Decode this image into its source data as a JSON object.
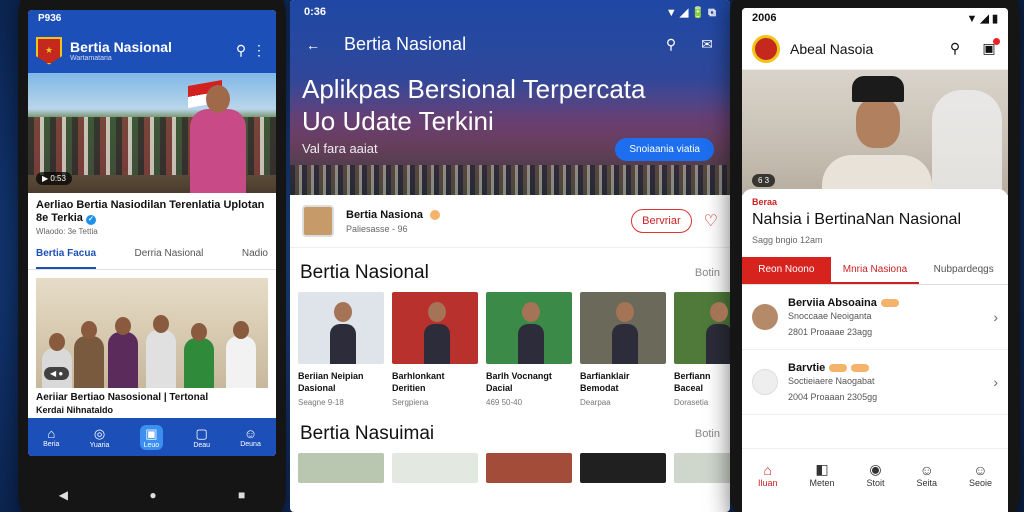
{
  "left": {
    "status_time": "P936",
    "app_title": "Bertia Nasional",
    "app_subtitle": "Wartamataria",
    "hero_badge": "0:53",
    "headline": "Aerliao Bertia Nasiodilan Terenlatia Uplotan 8e Terkia",
    "sub": "Wlaodo: 3e Tettia",
    "tabs": [
      "Bertia Facua",
      "Derria Nasional",
      "Nadio"
    ],
    "caption": "Aeriiar Bertiao Nasosional | Tertonal",
    "caption2": "Kerdai Nihnataldo",
    "nav": [
      {
        "icon": "⌂",
        "label": "Beria"
      },
      {
        "icon": "◎",
        "label": "Yuaria"
      },
      {
        "icon": "▣",
        "label": "Leuo"
      },
      {
        "icon": "▢",
        "label": "Deau"
      },
      {
        "icon": "☺",
        "label": "Deuna"
      }
    ],
    "sys": [
      "◀",
      "●",
      "■"
    ]
  },
  "mid": {
    "status_time": "0:36",
    "status_right": "▼ ◢ 🔋 ⧉",
    "title": "Bertia Nasional",
    "hero_line1": "Aplikpas Bersional Terpercata",
    "hero_line2": "Uo Udate Terkini",
    "hero_tag": "Val fara aaiat",
    "cta": "Snoiaania viatia",
    "channel_name": "Bertia Nasiona",
    "channel_sub": "Paliesasse - 96",
    "follow": "Bervriar",
    "section1": "Bertia Nasional",
    "section1_more": "Botin",
    "thumbs": [
      {
        "l1": "Beriian Neipian",
        "l2": "Dasional",
        "meta": "Seagne 9-18"
      },
      {
        "l1": "Barhlonkant",
        "l2": "Deritien",
        "meta": "Sergpiena"
      },
      {
        "l1": "Barlh Vocnangt",
        "l2": "Dacial",
        "meta": "469 50-40"
      },
      {
        "l1": "Barfianklair",
        "l2": "Bemodat",
        "meta": "Dearpaa"
      },
      {
        "l1": "Berfiann",
        "l2": "Baceal",
        "meta": "Dorasetia"
      }
    ],
    "section2": "Bertia Nasuimai",
    "section2_more": "Botin"
  },
  "right": {
    "status_time": "2006",
    "app_title": "Abeal Nasoia",
    "hero_badge": "6 3",
    "kicker": "Beraa",
    "title": "Nahsia i BertinaNan Nasional",
    "sub": "Sagg bngio 12am",
    "tabs": [
      "Reon Noono",
      "Mnria Nasiona",
      "Nubpardeqgs"
    ],
    "rows": [
      {
        "a": "Berviia Absoaina",
        "b": "Snoccaae Neoiganta",
        "c": "2801  Proaaae 23agg"
      },
      {
        "a": "Barvtie",
        "b": "Soctieiaere Naogabat",
        "c": "2004  Proaaan 2305gg"
      }
    ],
    "nav": [
      {
        "icon": "⌂",
        "label": "Iluan"
      },
      {
        "icon": "◧",
        "label": "Meten"
      },
      {
        "icon": "◉",
        "label": "Stoit"
      },
      {
        "icon": "☺",
        "label": "Seita"
      },
      {
        "icon": "☺",
        "label": "Seoie"
      }
    ]
  },
  "colors": {
    "primary_blue": "#1d4fb8",
    "accent_red": "#d7231e"
  }
}
